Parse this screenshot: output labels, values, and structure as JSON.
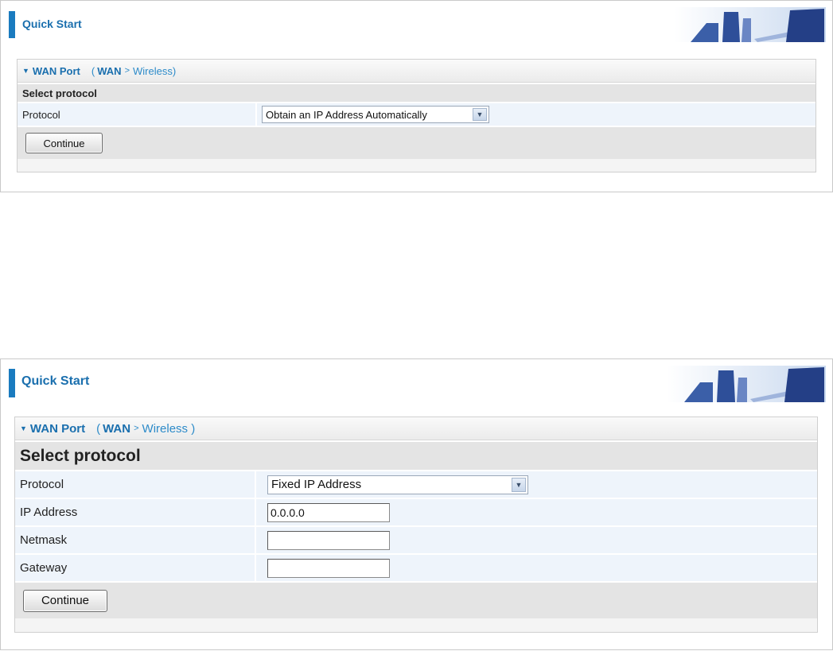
{
  "panels": [
    {
      "header_title": "Quick Start",
      "wan_title": "WAN Port",
      "crumb_open": "(",
      "crumb_wan": "WAN",
      "crumb_sep": ">",
      "crumb_wireless": "Wireless)",
      "select_protocol": "Select protocol",
      "protocol_label": "Protocol",
      "protocol_value": "Obtain an IP Address Automatically",
      "continue_label": "Continue"
    },
    {
      "header_title": "Quick Start",
      "wan_title": "WAN Port",
      "crumb_open": "(",
      "crumb_wan": "WAN",
      "crumb_sep": ">",
      "crumb_wireless": "Wireless )",
      "select_protocol": "Select protocol",
      "protocol_label": "Protocol",
      "protocol_value": "Fixed IP Address",
      "ip_label": "IP Address",
      "ip_value": "0.0.0.0",
      "netmask_label": "Netmask",
      "netmask_value": "",
      "gateway_label": "Gateway",
      "gateway_value": "",
      "continue_label": "Continue"
    }
  ],
  "colors": {
    "accent": "#1a7bbf",
    "link": "#2d8bc9",
    "row_bg": "#eef4fb",
    "section_bg": "#e4e4e4"
  },
  "icons": {
    "collapse": "triangle-down-icon",
    "dropdown": "chevron-down-icon",
    "header_art": "office-scene-illustration"
  }
}
